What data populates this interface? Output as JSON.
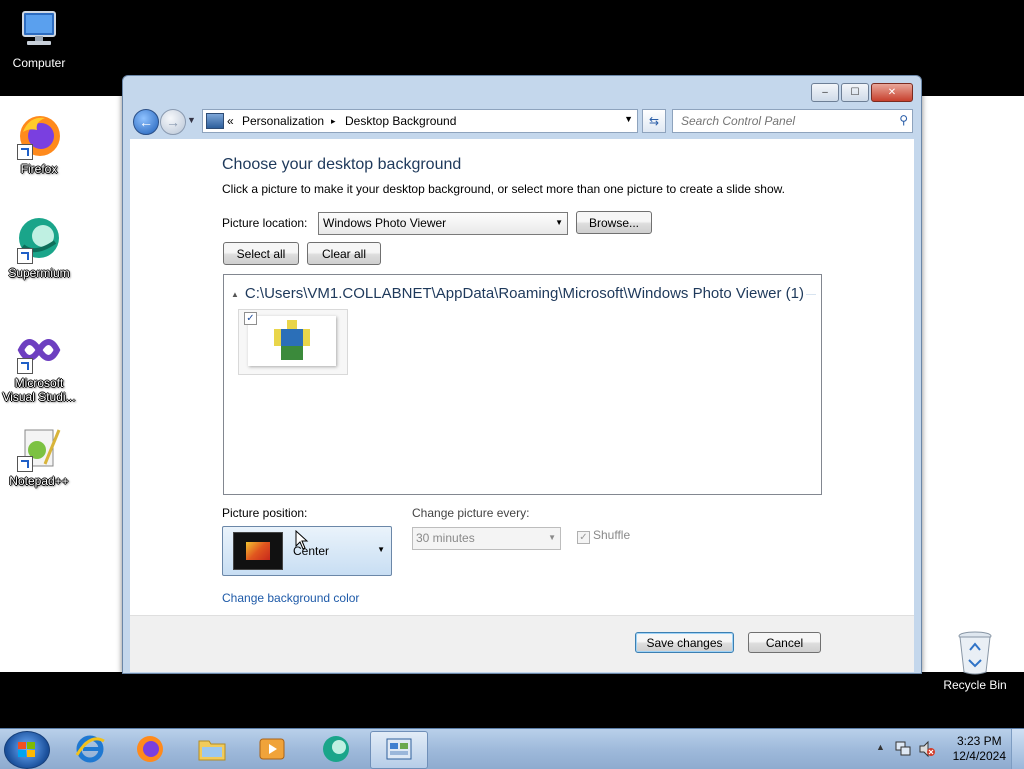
{
  "desktop": {
    "icons": [
      {
        "label": "Computer"
      },
      {
        "label": "Firefox"
      },
      {
        "label": "Supermium"
      },
      {
        "label": "Microsoft Visual Studi..."
      },
      {
        "label": "Notepad++"
      },
      {
        "label": "Recycle Bin"
      }
    ]
  },
  "window": {
    "breadcrumb": {
      "chevrons": "«",
      "part1": "Personalization",
      "sep": "▸",
      "part2": "Desktop Background"
    },
    "search_placeholder": "Search Control Panel",
    "controls": {
      "minimize": "–",
      "maximize": "☐",
      "close": "✕"
    }
  },
  "page": {
    "title": "Choose your desktop background",
    "subtitle": "Click a picture to make it your desktop background, or select more than one picture to create a slide show.",
    "location_label": "Picture location:",
    "location_value": "Windows Photo Viewer",
    "browse_label": "Browse...",
    "select_all_label": "Select all",
    "clear_all_label": "Clear all",
    "group_title": "C:\\Users\\VM1.COLLABNET\\AppData\\Roaming\\Microsoft\\Windows Photo Viewer (1)",
    "thumb_checked": "✓",
    "position_label": "Picture position:",
    "position_value": "Center",
    "change_every_label": "Change picture every:",
    "change_every_value": "30 minutes",
    "shuffle_label": "Shuffle",
    "shuffle_checked": "✓",
    "bg_color_link": "Change background color",
    "save_label": "Save changes",
    "cancel_label": "Cancel"
  },
  "taskbar": {
    "time": "3:23 PM",
    "date": "12/4/2024"
  }
}
